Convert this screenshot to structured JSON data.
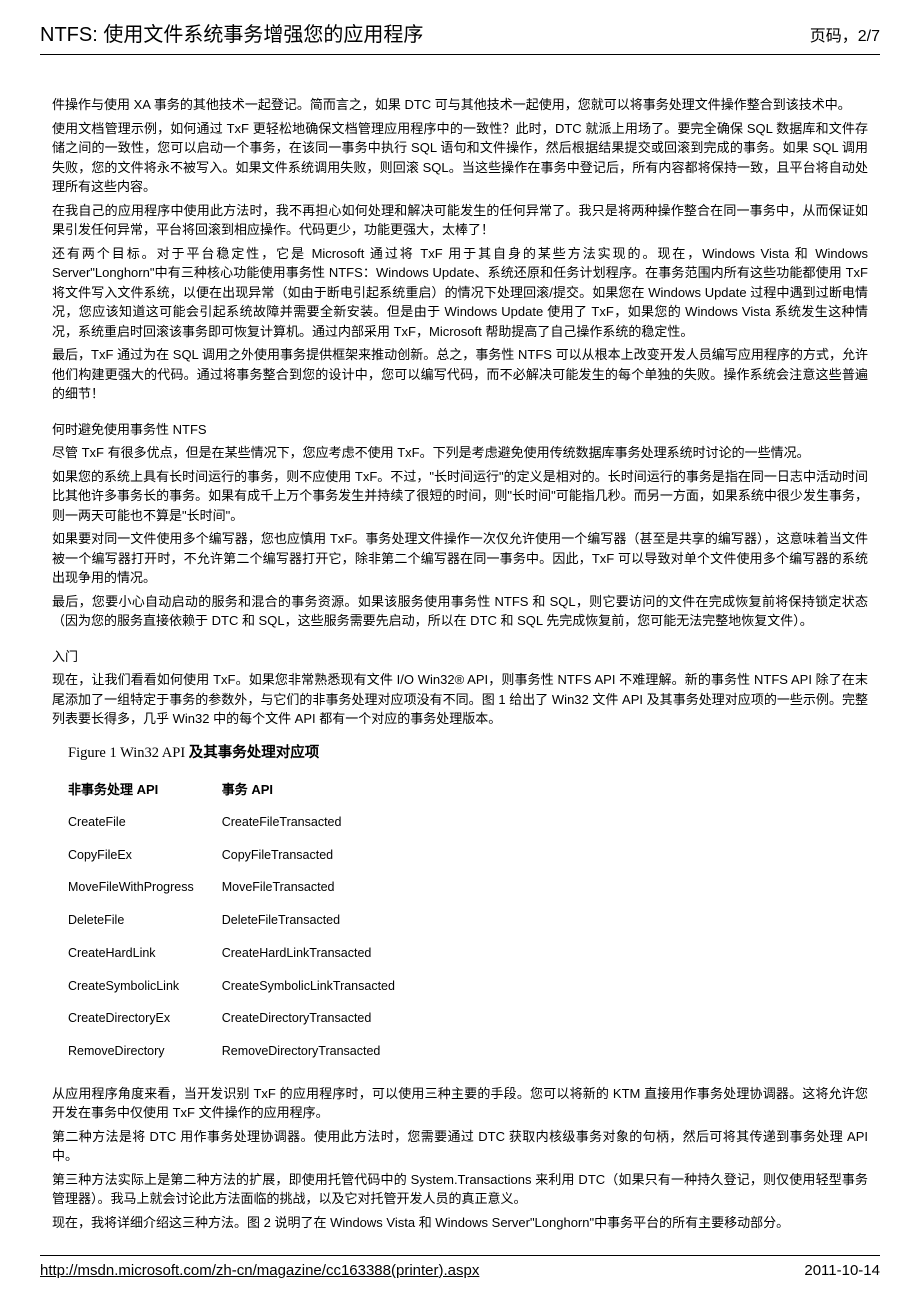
{
  "header": {
    "title": "NTFS: 使用文件系统事务增强您的应用程序",
    "page": "页码，2/7"
  },
  "body": {
    "p1": "件操作与使用 XA 事务的其他技术一起登记。简而言之，如果 DTC 可与其他技术一起使用，您就可以将事务处理文件操作整合到该技术中。",
    "p2": "使用文档管理示例，如何通过 TxF 更轻松地确保文档管理应用程序中的一致性？此时，DTC 就派上用场了。要完全确保 SQL 数据库和文件存储之间的一致性，您可以启动一个事务，在该同一事务中执行 SQL 语句和文件操作，然后根据结果提交或回滚到完成的事务。如果 SQL 调用失败，您的文件将永不被写入。如果文件系统调用失败，则回滚 SQL。当这些操作在事务中登记后，所有内容都将保持一致，且平台将自动处理所有这些内容。",
    "p3": "在我自己的应用程序中使用此方法时，我不再担心如何处理和解决可能发生的任何异常了。我只是将两种操作整合在同一事务中，从而保证如果引发任何异常，平台将回滚到相应操作。代码更少，功能更强大，太棒了！",
    "p4": "还有两个目标。对于平台稳定性，它是 Microsoft 通过将 TxF 用于其自身的某些方法实现的。现在，Windows Vista 和 Windows Server\"Longhorn\"中有三种核心功能使用事务性 NTFS：Windows Update、系统还原和任务计划程序。在事务范围内所有这些功能都使用 TxF 将文件写入文件系统，以便在出现异常（如由于断电引起系统重启）的情况下处理回滚/提交。如果您在 Windows Update 过程中遇到过断电情况，您应该知道这可能会引起系统故障并需要全新安装。但是由于 Windows Update 使用了 TxF，如果您的 Windows Vista 系统发生这种情况，系统重启时回滚该事务即可恢复计算机。通过内部采用 TxF，Microsoft 帮助提高了自己操作系统的稳定性。",
    "p5": "最后，TxF 通过为在 SQL 调用之外使用事务提供框架来推动创新。总之，事务性 NTFS 可以从根本上改变开发人员编写应用程序的方式，允许他们构建更强大的代码。通过将事务整合到您的设计中，您可以编写代码，而不必解决可能发生的每个单独的失败。操作系统会注意这些普遍的细节！",
    "h1": "何时避免使用事务性 NTFS",
    "p6": "尽管 TxF 有很多优点，但是在某些情况下，您应考虑不使用 TxF。下列是考虑避免使用传统数据库事务处理系统时讨论的一些情况。",
    "p7": "如果您的系统上具有长时间运行的事务，则不应使用 TxF。不过，\"长时间运行\"的定义是相对的。长时间运行的事务是指在同一日志中活动时间比其他许多事务长的事务。如果有成千上万个事务发生并持续了很短的时间，则\"长时间\"可能指几秒。而另一方面，如果系统中很少发生事务，则一两天可能也不算是\"长时间\"。",
    "p8": "如果要对同一文件使用多个编写器，您也应慎用 TxF。事务处理文件操作一次仅允许使用一个编写器（甚至是共享的编写器），这意味着当文件被一个编写器打开时，不允许第二个编写器打开它，除非第二个编写器在同一事务中。因此，TxF 可以导致对单个文件使用多个编写器的系统出现争用的情况。",
    "p9": "最后，您要小心自动启动的服务和混合的事务资源。如果该服务使用事务性 NTFS 和 SQL，则它要访问的文件在完成恢复前将保持锁定状态（因为您的服务直接依赖于 DTC 和 SQL，这些服务需要先启动，所以在 DTC 和 SQL 先完成恢复前，您可能无法完整地恢复文件）。",
    "h2": "入门",
    "p10": "现在，让我们看看如何使用 TxF。如果您非常熟悉现有文件 I/O Win32® API，则事务性 NTFS API 不难理解。新的事务性 NTFS API 除了在末尾添加了一组特定于事务的参数外，与它们的非事务处理对应项没有不同。图 1 给出了 Win32 文件 API 及其事务处理对应项的一些示例。完整列表要长得多，几乎 Win32 中的每个文件 API 都有一个对应的事务处理版本。",
    "figure_title_prefix": "Figure 1 Win32 API ",
    "figure_title_bold": "及其事务处理对应项",
    "table": {
      "header": {
        "col1": "非事务处理 API",
        "col2": "事务 API"
      },
      "rows": [
        {
          "col1": "CreateFile",
          "col2": "CreateFileTransacted"
        },
        {
          "col1": "CopyFileEx",
          "col2": "CopyFileTransacted"
        },
        {
          "col1": "MoveFileWithProgress",
          "col2": "MoveFileTransacted"
        },
        {
          "col1": "DeleteFile",
          "col2": "DeleteFileTransacted"
        },
        {
          "col1": "CreateHardLink",
          "col2": "CreateHardLinkTransacted"
        },
        {
          "col1": "CreateSymbolicLink",
          "col2": "CreateSymbolicLinkTransacted"
        },
        {
          "col1": "CreateDirectoryEx",
          "col2": "CreateDirectoryTransacted"
        },
        {
          "col1": "RemoveDirectory",
          "col2": "RemoveDirectoryTransacted"
        }
      ]
    },
    "p11": "从应用程序角度来看，当开发识别 TxF 的应用程序时，可以使用三种主要的手段。您可以将新的 KTM 直接用作事务处理协调器。这将允许您开发在事务中仅使用 TxF 文件操作的应用程序。",
    "p12": "第二种方法是将 DTC 用作事务处理协调器。使用此方法时，您需要通过 DTC 获取内核级事务对象的句柄，然后可将其传递到事务处理 API 中。",
    "p13": "第三种方法实际上是第二种方法的扩展，即使用托管代码中的 System.Transactions 来利用 DTC（如果只有一种持久登记，则仅使用轻型事务管理器）。我马上就会讨论此方法面临的挑战，以及它对托管开发人员的真正意义。",
    "p14": "现在，我将详细介绍这三种方法。图 2 说明了在 Windows Vista 和 Windows Server\"Longhorn\"中事务平台的所有主要移动部分。"
  },
  "footer": {
    "url": "http://msdn.microsoft.com/zh-cn/magazine/cc163388(printer).aspx",
    "date": "2011-10-14"
  }
}
